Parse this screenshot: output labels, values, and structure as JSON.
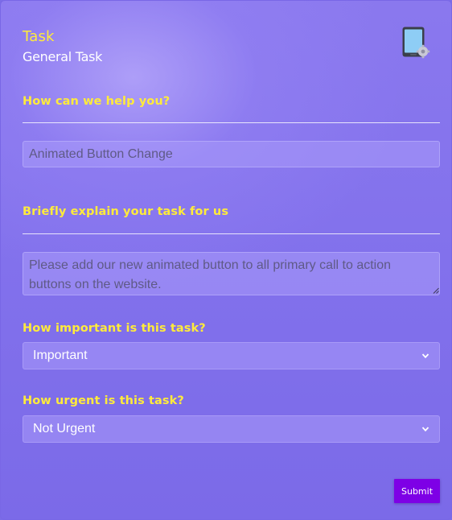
{
  "header": {
    "title": "Task",
    "subtitle": "General Task",
    "icon": "tablet-settings-icon"
  },
  "form": {
    "help": {
      "label": "How can we help you?",
      "value": "Animated Button Change"
    },
    "explain": {
      "label": "Briefly explain your task for us",
      "value": "Please add our new animated button to all primary call to action buttons on the website."
    },
    "importance": {
      "label": "How important is this task?",
      "selected": "Important"
    },
    "urgency": {
      "label": "How urgent is this task?",
      "selected": "Not Urgent"
    },
    "submit_label": "Submit"
  },
  "colors": {
    "label": "#ffeb3b",
    "submit": "#7e00e6",
    "background": "#8a78ee"
  }
}
